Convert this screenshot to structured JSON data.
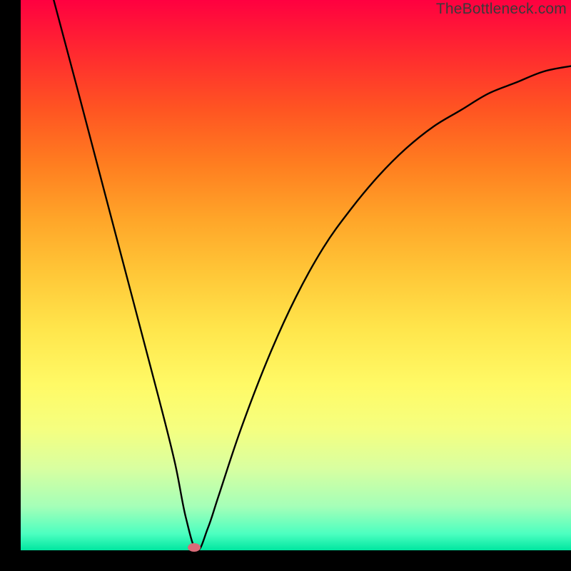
{
  "watermark": "TheBottleneck.com",
  "chart_data": {
    "type": "line",
    "title": "",
    "xlabel": "",
    "ylabel": "",
    "xlim": [
      0,
      100
    ],
    "ylim": [
      0,
      100
    ],
    "series": [
      {
        "name": "curve",
        "x": [
          6,
          10,
          15,
          20,
          25,
          28,
          30,
          32,
          34,
          36,
          40,
          45,
          50,
          55,
          60,
          65,
          70,
          75,
          80,
          85,
          90,
          95,
          100
        ],
        "y": [
          100,
          85,
          66,
          47,
          28,
          16,
          6,
          0,
          4,
          10,
          22,
          35,
          46,
          55,
          62,
          68,
          73,
          77,
          80,
          83,
          85,
          87,
          88
        ]
      }
    ],
    "marker": {
      "x": 31.5,
      "y": 0.5
    },
    "gradient_stops": [
      {
        "pos": 0,
        "color": "#ff0040"
      },
      {
        "pos": 50,
        "color": "#ffc838"
      },
      {
        "pos": 78,
        "color": "#f5ff80"
      },
      {
        "pos": 100,
        "color": "#00e6a0"
      }
    ]
  }
}
